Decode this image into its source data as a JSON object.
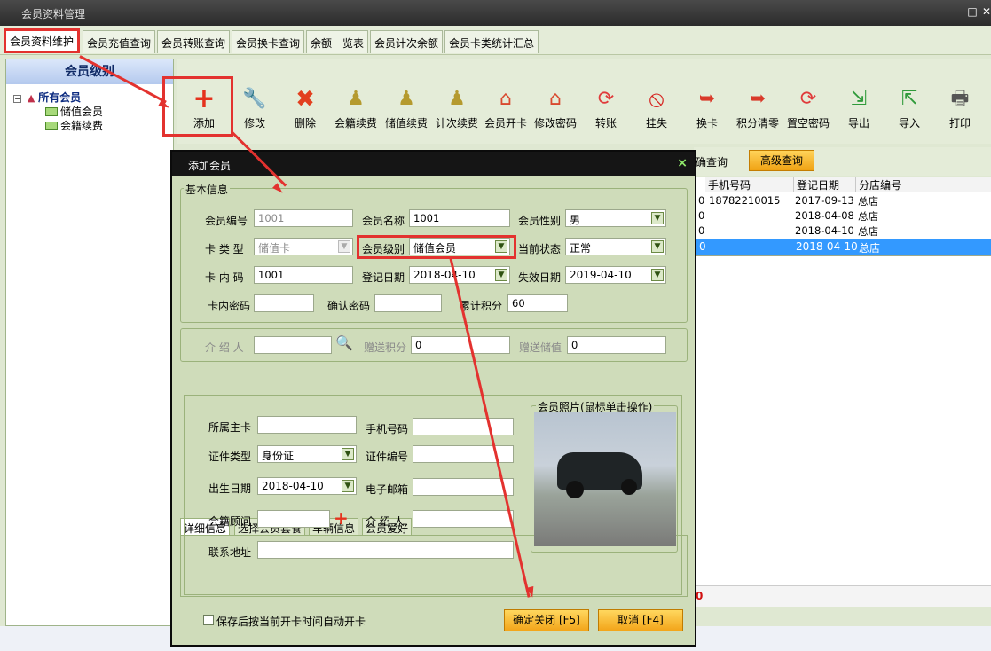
{
  "window": {
    "title": "会员资料管理",
    "controls": [
      "-",
      "□",
      "✕"
    ]
  },
  "tabs": [
    "会员资料维护",
    "会员充值查询",
    "会员转账查询",
    "会员换卡查询",
    "余额一览表",
    "会员计次余额",
    "会员卡类统计汇总"
  ],
  "left": {
    "header": "会员级别",
    "root": "所有会员",
    "children": [
      "储值会员",
      "会籍续费"
    ]
  },
  "toolbar": [
    "添加",
    "修改",
    "删除",
    "会籍续费",
    "储值续费",
    "计次续费",
    "会员开卡",
    "修改密码",
    "转账",
    "挂失",
    "换卡",
    "积分清零",
    "置空密码",
    "导出",
    "导入",
    "打印"
  ],
  "search": {
    "partial_label": "确查询",
    "advanced": "高级查询"
  },
  "grid": {
    "headers": [
      "手机号码",
      "登记日期",
      "分店编号"
    ],
    "rows": [
      {
        "prefix": "0",
        "phone": "18782210015",
        "date": "2017-09-13",
        "branch": "总店"
      },
      {
        "prefix": "0",
        "phone": "",
        "date": "2018-04-08",
        "branch": "总店"
      },
      {
        "prefix": "0",
        "phone": "",
        "date": "2018-04-10",
        "branch": "总店"
      },
      {
        "prefix": "0",
        "phone": "",
        "date": "2018-04-10",
        "branch": "总店"
      }
    ],
    "footer_value": "0"
  },
  "dialog": {
    "title": "添加会员",
    "close": "×",
    "basic": {
      "legend": "基本信息",
      "member_no_label": "会员编号",
      "member_no": "1001",
      "member_name_label": "会员名称",
      "member_name": "1001",
      "gender_label": "会员性别",
      "gender": "男",
      "card_type_label": "卡 类 型",
      "card_type": "储值卡",
      "level_label": "会员级别",
      "level": "储值会员",
      "status_label": "当前状态",
      "status": "正常",
      "card_code_label": "卡 内 码",
      "card_code": "1001",
      "reg_date_label": "登记日期",
      "reg_date": "2018-04-10",
      "expire_label": "失效日期",
      "expire_date": "2019-04-10",
      "pwd_label": "卡内密码",
      "pwd": "",
      "confirm_label": "确认密码",
      "confirm": "",
      "points_label": "累计积分",
      "points": "60"
    },
    "intro": {
      "referrer_label": "介 绍 人",
      "referrer": "",
      "gift_points_label": "赠送积分",
      "gift_points": "0",
      "gift_value_label": "赠送储值",
      "gift_value": "0"
    },
    "subtabs": [
      "详细信息",
      "选择会员套餐",
      "车辆信息",
      "会员爱好"
    ],
    "detail": {
      "main_card_label": "所属主卡",
      "main_card": "",
      "mobile_label": "手机号码",
      "mobile": "",
      "id_type_label": "证件类型",
      "id_type": "身份证",
      "id_no_label": "证件编号",
      "id_no": "",
      "birth_label": "出生日期",
      "birth": "2018-04-10",
      "email_label": "电子邮箱",
      "email": "",
      "advisor_label": "会籍顾问",
      "advisor": "",
      "intro_label": "介 绍 人",
      "intro": "",
      "address_label": "联系地址",
      "address": ""
    },
    "photo_legend": "会员照片(鼠标单击操作)",
    "auto_open_label": "保存后按当前开卡时间自动开卡",
    "confirm_btn": "确定关闭 [F5]",
    "cancel_btn": "取消 [F4]"
  },
  "colors": {
    "accent_red": "#e3322f",
    "dialog_bg": "#cfdcba",
    "orange_button": "#f3a51a",
    "selection": "#3399ff"
  }
}
